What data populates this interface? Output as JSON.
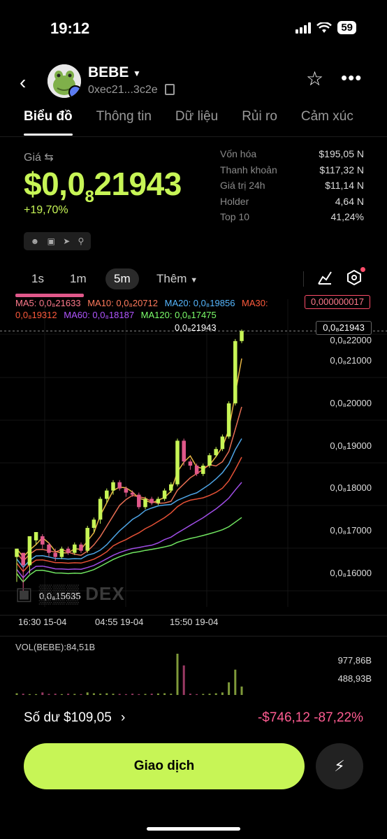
{
  "status_bar": {
    "time": "19:12",
    "battery": "59"
  },
  "header": {
    "token_name": "BEBE",
    "address": "0xec21...3c2e"
  },
  "tabs": [
    {
      "label": "Biểu đồ",
      "active": true
    },
    {
      "label": "Thông tin",
      "active": false
    },
    {
      "label": "Dữ liệu",
      "active": false
    },
    {
      "label": "Rủi ro",
      "active": false
    },
    {
      "label": "Cảm xúc",
      "active": false
    }
  ],
  "price": {
    "label": "Giá",
    "main_prefix": "$0,0",
    "subscript": "8",
    "main_suffix": "21943",
    "change": "+19,70%"
  },
  "stats": [
    {
      "k": "Vốn hóa",
      "v": "$195,05 N"
    },
    {
      "k": "Thanh khoản",
      "v": "$117,32 N"
    },
    {
      "k": "Giá trị 24h",
      "v": "$11,14 N"
    },
    {
      "k": "Holder",
      "v": "4,64 N"
    },
    {
      "k": "Top 10",
      "v": "41,24%"
    }
  ],
  "timeframes": {
    "t1": "1s",
    "t2": "1m",
    "t3": "5m",
    "more": "Thêm"
  },
  "ma": {
    "ma5": "MA5: 0,0₈21633",
    "ma10": "MA10: 0,0₈20712",
    "ma20": "MA20: 0,0₈19856",
    "ma30": "MA30:",
    "ma30_val": "0,0₈19312",
    "ma60": "MA60: 0,0₈18187",
    "ma120": "MA120: 0,0₈17475",
    "box": "0,000000017"
  },
  "chart_labels": {
    "current": "0,0₈21943",
    "current_box": "0,0₈21943",
    "min": "0,0₈15635",
    "watermark": "DEX",
    "y_ticks": [
      "0,0₈22000",
      "0,0₈21000",
      "0,0₈20000",
      "0,0₈19000",
      "0,0₈18000",
      "0,0₈17000",
      "0,0₈16000"
    ],
    "x_ticks": [
      "16:30 15-04",
      "04:55 19-04",
      "15:50 19-04"
    ],
    "vol_title": "VOL(BEBE):84,51B",
    "vol_ticks": [
      "977,86B",
      "488,93B"
    ]
  },
  "chart_data": {
    "type": "candlestick",
    "ylim": [
      15635,
      22000
    ],
    "y_unit": "× 1e-9 USD (0,0₈ prefix)",
    "x_ticks": [
      "16:30 15-04",
      "04:55 19-04",
      "15:50 19-04"
    ],
    "candles": [
      [
        16500,
        16700,
        15900,
        16600
      ],
      [
        16600,
        16300,
        15635,
        16400
      ],
      [
        16300,
        17000,
        16100,
        16900
      ],
      [
        16900,
        17100,
        16800,
        17000
      ],
      [
        17000,
        16800,
        16700,
        17050
      ],
      [
        16800,
        16600,
        16500,
        16850
      ],
      [
        16600,
        16500,
        16400,
        16700
      ],
      [
        16500,
        16700,
        16450,
        16750
      ],
      [
        16700,
        16600,
        16550,
        16750
      ],
      [
        16600,
        16800,
        16550,
        16850
      ],
      [
        16800,
        16650,
        16600,
        16850
      ],
      [
        16650,
        17200,
        16600,
        17250
      ],
      [
        17200,
        17400,
        17100,
        17450
      ],
      [
        17400,
        17900,
        17300,
        17950
      ],
      [
        17900,
        18100,
        17800,
        18150
      ],
      [
        18100,
        18300,
        18000,
        18350
      ],
      [
        18300,
        18150,
        18100,
        18350
      ],
      [
        18150,
        18050,
        17950,
        18200
      ],
      [
        18050,
        18000,
        17950,
        18100
      ],
      [
        18000,
        17700,
        17650,
        18050
      ],
      [
        17700,
        17900,
        17650,
        17950
      ],
      [
        17900,
        17800,
        17750,
        17950
      ],
      [
        17800,
        17900,
        17750,
        17950
      ],
      [
        17900,
        18100,
        17850,
        18150
      ],
      [
        18100,
        18250,
        18050,
        18300
      ],
      [
        18250,
        19300,
        18200,
        19350
      ],
      [
        19300,
        18800,
        18700,
        19350
      ],
      [
        18800,
        18700,
        18600,
        18850
      ],
      [
        18700,
        18500,
        18450,
        18750
      ],
      [
        18500,
        18700,
        18450,
        18750
      ],
      [
        18700,
        18950,
        18650,
        19000
      ],
      [
        18950,
        19100,
        18900,
        19150
      ],
      [
        19100,
        19400,
        19050,
        19450
      ],
      [
        19400,
        20200,
        19350,
        20250
      ],
      [
        20200,
        21700,
        20150,
        21750
      ],
      [
        21700,
        21943,
        21650,
        21980
      ]
    ],
    "volumes": [
      40,
      30,
      20,
      20,
      60,
      25,
      30,
      20,
      30,
      25,
      20,
      60,
      40,
      30,
      40,
      30,
      25,
      20,
      30,
      20,
      25,
      30,
      35,
      40,
      30,
      977,
      700,
      30,
      20,
      25,
      30,
      40,
      60,
      300,
      600,
      200
    ],
    "series": [
      {
        "name": "MA5",
        "color": "#ffc84a"
      },
      {
        "name": "MA10",
        "color": "#ff7a5c"
      },
      {
        "name": "MA20",
        "color": "#56b7ff"
      },
      {
        "name": "MA30",
        "color": "#ff5a3c"
      },
      {
        "name": "MA60",
        "color": "#b055ff"
      },
      {
        "name": "MA120",
        "color": "#7dff6b"
      }
    ]
  },
  "bottom": {
    "balance": "Số dư $109,05",
    "pnl": "-$746,12 -87,22%",
    "trade_button": "Giao dịch"
  }
}
